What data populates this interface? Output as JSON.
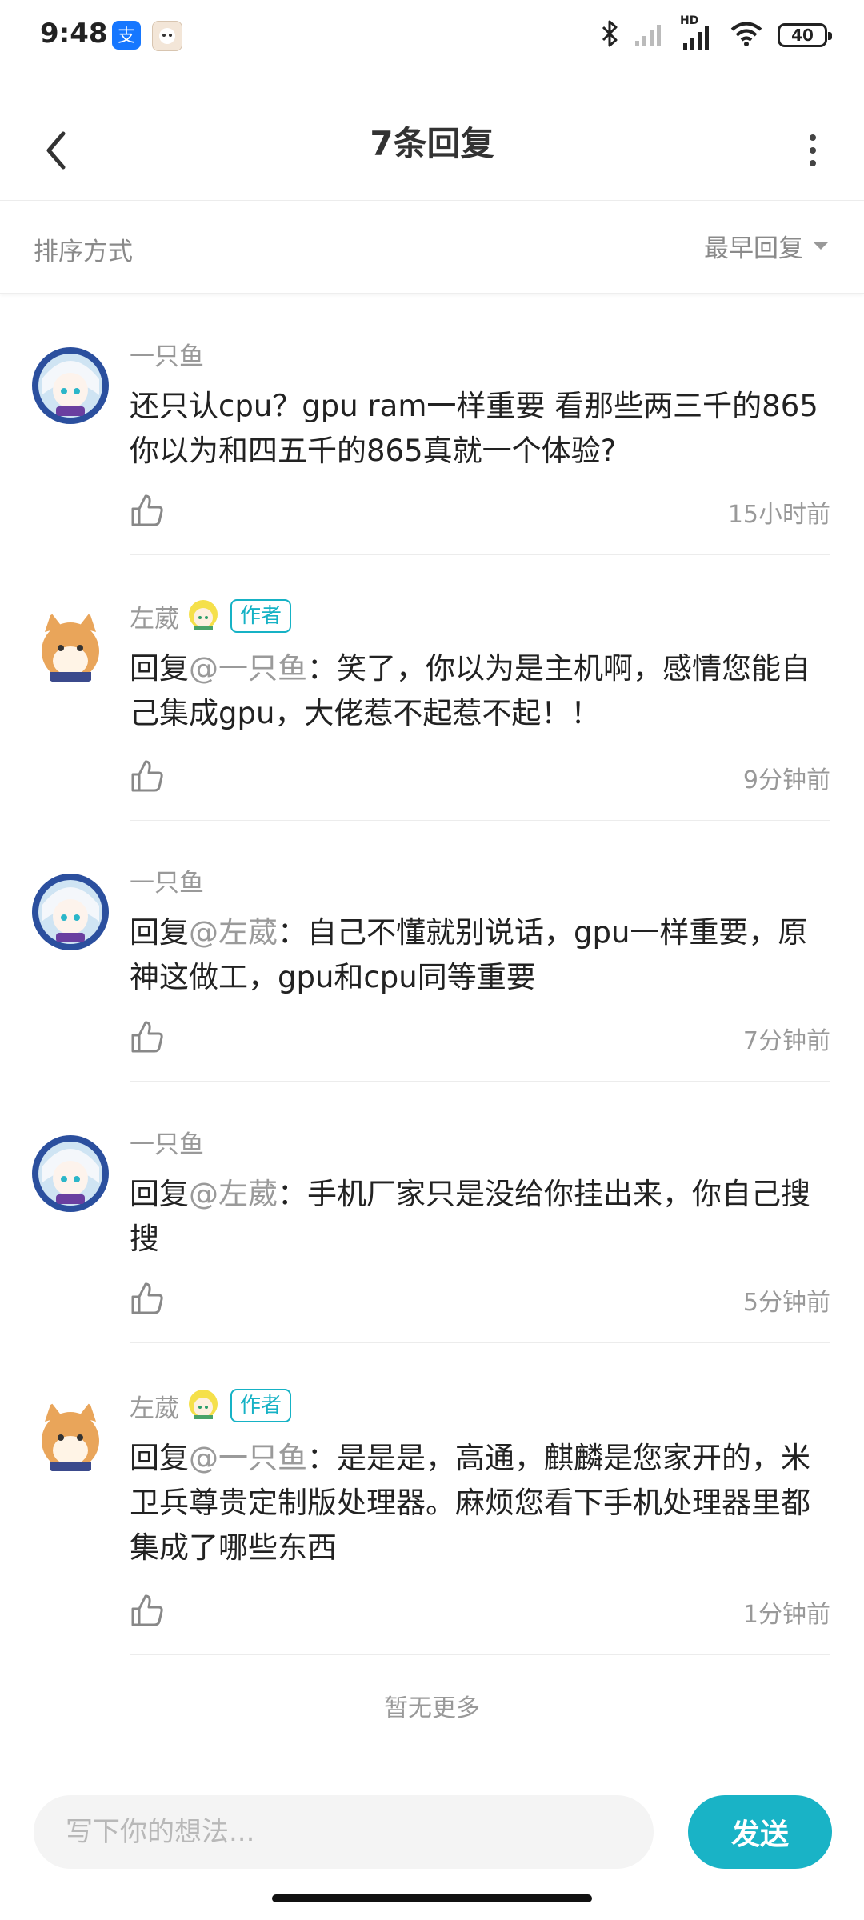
{
  "status_bar": {
    "time": "9:48",
    "network_label": "HD",
    "battery": "40",
    "icons": [
      "alipay-icon",
      "app-avatar-icon",
      "bluetooth-icon",
      "signal-icon",
      "wifi-icon",
      "battery-icon"
    ]
  },
  "header": {
    "title": "7条回复",
    "icons": [
      "back-icon",
      "more-vertical-icon"
    ]
  },
  "sort": {
    "label": "排序方式",
    "value": "最早回复"
  },
  "comments": [
    {
      "username": "一只鱼",
      "avatar": "girl-avatar",
      "text": "还只认cpu？gpu  ram一样重要   看那些两三千的865你以为和四五千的865真就一个体验?",
      "time": "15小时前"
    },
    {
      "username": "左葳",
      "avatar": "shiba-avatar",
      "badge": "作者",
      "reply_prefix": "回复",
      "mention": "@一只鱼",
      "text": "：笑了，你以为是主机啊，感情您能自己集成gpu，大佬惹不起惹不起！！",
      "time": "9分钟前"
    },
    {
      "username": "一只鱼",
      "avatar": "girl-avatar",
      "reply_prefix": "回复",
      "mention": "@左葳",
      "text": "：自己不懂就别说话，gpu一样重要，原神这做工，gpu和cpu同等重要",
      "time": "7分钟前"
    },
    {
      "username": "一只鱼",
      "avatar": "girl-avatar",
      "reply_prefix": "回复",
      "mention": "@左葳",
      "text": "：手机厂家只是没给你挂出来，你自己搜搜",
      "time": "5分钟前"
    },
    {
      "username": "左葳",
      "avatar": "shiba-avatar",
      "badge": "作者",
      "reply_prefix": "回复",
      "mention": "@一只鱼",
      "text": "：是是是，高通，麒麟是您家开的，米卫兵尊贵定制版处理器。麻烦您看下手机处理器里都集成了哪些东西",
      "time": "1分钟前"
    }
  ],
  "footer_text": "暂无更多",
  "composer": {
    "placeholder": "写下你的想法...",
    "send_label": "发送"
  },
  "colors": {
    "accent": "#19b3c6",
    "muted_text": "#999999",
    "primary_text": "#222222"
  }
}
